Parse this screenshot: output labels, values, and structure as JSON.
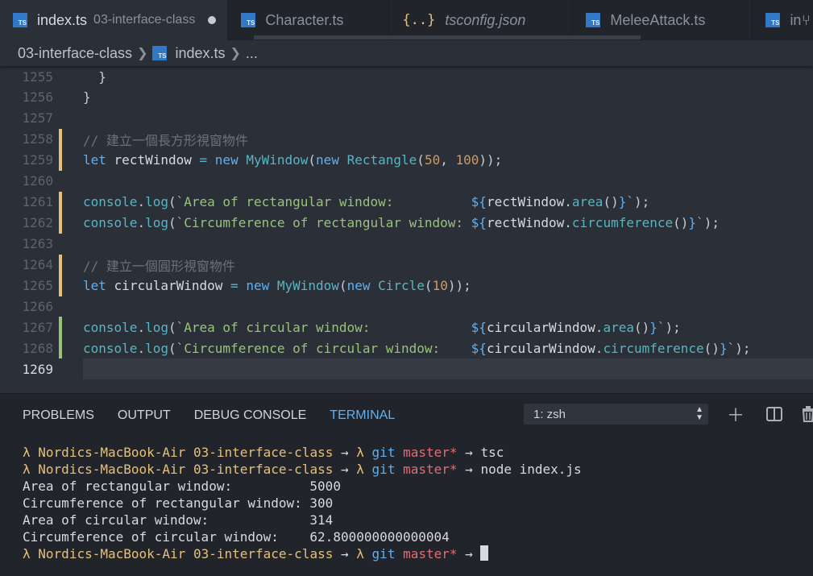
{
  "tabs": [
    {
      "name": "index.ts",
      "sub": "03-interface-class",
      "active": true,
      "dirty": true,
      "icon": "ts-icon"
    },
    {
      "name": "Character.ts",
      "active": false,
      "icon": "ts-icon"
    },
    {
      "name": "tsconfig.json",
      "active": false,
      "icon": "json-icon",
      "italic": true
    },
    {
      "name": "MeleeAttack.ts",
      "active": false,
      "icon": "ts-icon"
    },
    {
      "name": "inde",
      "active": false,
      "icon": "ts-icon"
    }
  ],
  "ts_icon_text": "TS",
  "json_icon_text": "{..}",
  "breadcrumb": {
    "folder": "03-interface-class",
    "file": "index.ts",
    "more": "..."
  },
  "editor": {
    "lines": [
      {
        "n": "1255",
        "text": "  }"
      },
      {
        "n": "1256",
        "text": "}"
      },
      {
        "n": "1257",
        "text": ""
      },
      {
        "n": "1258",
        "text": "// 建立一個長方形視窗物件",
        "mark": "mod"
      },
      {
        "n": "1259",
        "text": "let rectWindow = new MyWindow(new Rectangle(50, 100));",
        "mark": "mod"
      },
      {
        "n": "1260",
        "text": ""
      },
      {
        "n": "1261",
        "text": "console.log(`Area of rectangular window:          ${rectWindow.area()}`);",
        "mark": "mod"
      },
      {
        "n": "1262",
        "text": "console.log(`Circumference of rectangular window: ${rectWindow.circumference()}`);",
        "mark": "mod"
      },
      {
        "n": "1263",
        "text": ""
      },
      {
        "n": "1264",
        "text": "// 建立一個圓形視窗物件",
        "mark": "mod"
      },
      {
        "n": "1265",
        "text": "let circularWindow = new MyWindow(new Circle(10));",
        "mark": "mod"
      },
      {
        "n": "1266",
        "text": ""
      },
      {
        "n": "1267",
        "text": "console.log(`Area of circular window:             ${circularWindow.area()}`);",
        "mark": "add"
      },
      {
        "n": "1268",
        "text": "console.log(`Circumference of circular window:    ${circularWindow.circumference()}`);",
        "mark": "add"
      },
      {
        "n": "1269",
        "text": "",
        "current": true
      }
    ]
  },
  "panel": {
    "tabs": [
      "PROBLEMS",
      "OUTPUT",
      "DEBUG CONSOLE",
      "TERMINAL"
    ],
    "active_tab": "TERMINAL",
    "terminal_select": "1: zsh",
    "actions": [
      "plus-icon",
      "split-icon",
      "trash-icon"
    ]
  },
  "terminal": {
    "prompt": {
      "lambda": "λ",
      "host": "Nordics-MacBook-Air",
      "dir": "03-interface-class",
      "arrow": "→",
      "git": "git",
      "branch": "master*"
    },
    "lines": [
      {
        "type": "cmd",
        "cmd": "tsc"
      },
      {
        "type": "cmd",
        "cmd": "node index.js"
      },
      {
        "type": "out",
        "text": "Area of rectangular window:          5000"
      },
      {
        "type": "out",
        "text": "Circumference of rectangular window: 300"
      },
      {
        "type": "out",
        "text": "Area of circular window:             314"
      },
      {
        "type": "out",
        "text": "Circumference of circular window:    62.800000000000004"
      },
      {
        "type": "cmd",
        "cmd": "",
        "cursor": true
      }
    ]
  }
}
